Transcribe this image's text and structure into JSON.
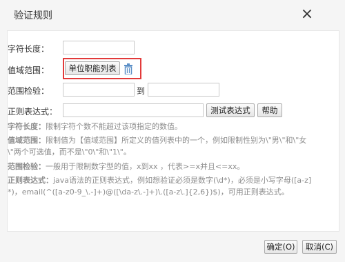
{
  "dialog": {
    "title": "验证规则",
    "close_glyph": "×"
  },
  "form": {
    "length_label": "字符长度：",
    "length_value": "",
    "domain_label": "值域范围：",
    "domain_button": "单位职能列表",
    "range_label": "范围检验：",
    "range_from": "",
    "range_to_label": "到",
    "range_to": "",
    "regex_label": "正则表达式：",
    "regex_value": "",
    "test_button": "测试表达式",
    "help_button": "帮助"
  },
  "help": {
    "length_term": "字符长度：",
    "length_text": "限制字符个数不能超过该项指定的数值。",
    "domain_term": "值域范围：",
    "domain_text_1": "限制值为【值域范围】所定义的值列表中的一个，例如限制性别为\\\"男\\\"和\\\"女",
    "domain_text_2": "\\\"两个可选值，而不是\\\"0\\\"和\\\"1\\\"。",
    "range_term": "范围检验：",
    "range_text": "一般用于限制数字型的值，x到xx ，代表>=x并且<=xx。",
    "regex_term": "正则表达式：",
    "regex_text_1": "java语法的正则表达式，例如想验证必须是数字(\\d*)，必须是小写字母([a-z]",
    "regex_text_2": "*)，email(^([a-z0-9_\\.-]+)@([\\da-z\\.-]+)\\.([a-z\\.]{2,6})$)，可用正则表达式。"
  },
  "footer": {
    "ok_button": "确定(O)",
    "cancel_button": "取消(C)"
  },
  "colors": {
    "highlight": "#e23a3a",
    "trash_icon": "#5b8fc7",
    "help_text": "#8c8c8c"
  },
  "icons": [
    "close-icon",
    "trash-icon"
  ]
}
